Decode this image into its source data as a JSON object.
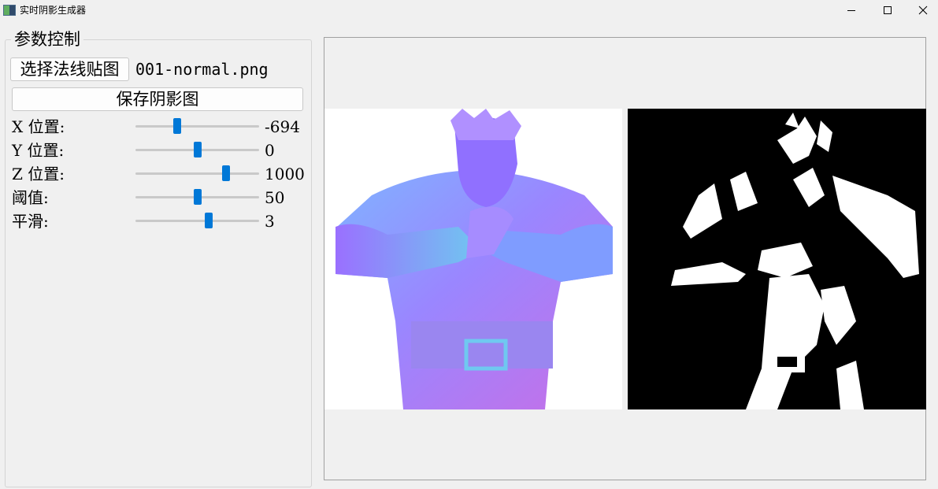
{
  "window": {
    "title": "实时阴影生成器",
    "icon": "app-icon"
  },
  "controls": {
    "group_title": "参数控制",
    "choose_button": "选择法线贴图",
    "file_name": "001-normal.png",
    "save_button": "保存阴影图",
    "sliders": [
      {
        "label": "X 位置:",
        "value": "-694",
        "fraction": 0.34
      },
      {
        "label": "Y 位置:",
        "value": "0",
        "fraction": 0.5
      },
      {
        "label": "Z 位置:",
        "value": "1000",
        "fraction": 0.73
      },
      {
        "label": "阈值:",
        "value": "50",
        "fraction": 0.5
      },
      {
        "label": "平滑:",
        "value": "3",
        "fraction": 0.59
      }
    ]
  },
  "preview": {
    "normal_map": "normal-map-image",
    "shadow_map": "shadow-map-image"
  },
  "colors": {
    "accent": "#0078d7",
    "normal_blue": "#7f7fff",
    "normal_pink": "#c86ee6",
    "normal_cyan": "#6fc8f0"
  }
}
